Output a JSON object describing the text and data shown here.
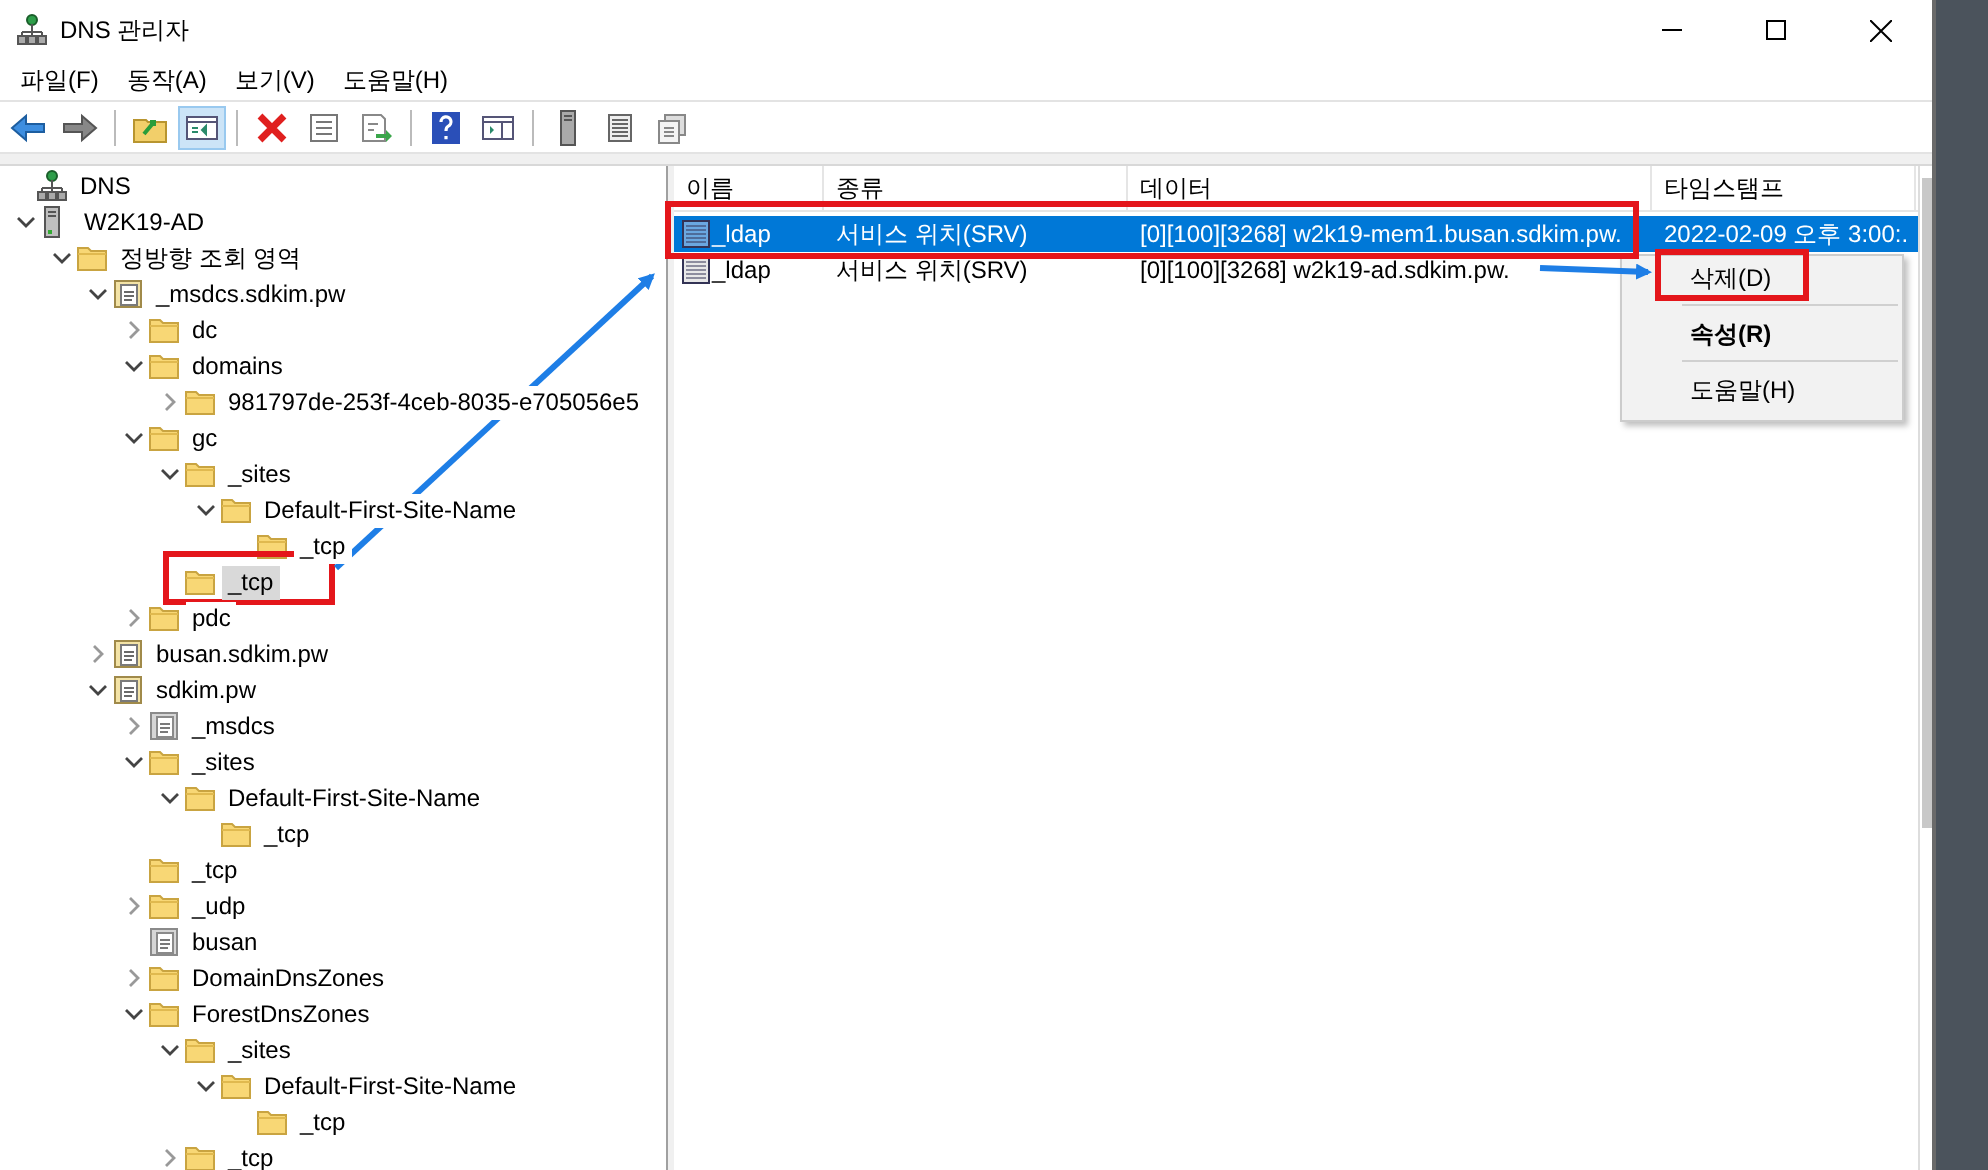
{
  "window": {
    "title": "DNS 관리자"
  },
  "menu": [
    "파일(F)",
    "동작(A)",
    "보기(V)",
    "도움말(H)"
  ],
  "toolbar": [
    {
      "kind": "back"
    },
    {
      "kind": "forward"
    },
    {
      "kind": "sep"
    },
    {
      "kind": "up"
    },
    {
      "kind": "tree-toggle",
      "pressed": true
    },
    {
      "kind": "sep"
    },
    {
      "kind": "delete"
    },
    {
      "kind": "properties"
    },
    {
      "kind": "export"
    },
    {
      "kind": "sep"
    },
    {
      "kind": "help"
    },
    {
      "kind": "action-pane"
    },
    {
      "kind": "sep"
    },
    {
      "kind": "server"
    },
    {
      "kind": "list"
    },
    {
      "kind": "copy"
    }
  ],
  "tree": [
    {
      "label": "DNS",
      "kind": "dns",
      "selected": false,
      "children": [
        {
          "label": "W2K19-AD",
          "kind": "server",
          "expanded": true,
          "selected": false,
          "children": [
            {
              "label": "정방향 조회 영역",
              "kind": "folder",
              "expanded": true,
              "selected": false,
              "children": [
                {
                  "label": "_msdcs.sdkim.pw",
                  "kind": "zone",
                  "expanded": true,
                  "selected": false,
                  "children": [
                    {
                      "label": "dc",
                      "kind": "folder",
                      "expanded": false,
                      "selected": false
                    },
                    {
                      "label": "domains",
                      "kind": "folder",
                      "expanded": true,
                      "selected": false,
                      "children": [
                        {
                          "label": "981797de-253f-4ceb-8035-e705056e5",
                          "kind": "folder",
                          "expanded": false,
                          "selected": false
                        }
                      ]
                    },
                    {
                      "label": "gc",
                      "kind": "folder",
                      "expanded": true,
                      "selected": false,
                      "children": [
                        {
                          "label": "_sites",
                          "kind": "folder",
                          "expanded": true,
                          "selected": false,
                          "children": [
                            {
                              "label": "Default-First-Site-Name",
                              "kind": "folder",
                              "expanded": true,
                              "selected": false,
                              "children": [
                                {
                                  "label": "_tcp",
                                  "kind": "folder",
                                  "selected": false
                                }
                              ]
                            }
                          ]
                        },
                        {
                          "label": "_tcp",
                          "kind": "folder",
                          "selected": true
                        }
                      ]
                    },
                    {
                      "label": "pdc",
                      "kind": "folder",
                      "expanded": false,
                      "selected": false
                    }
                  ]
                },
                {
                  "label": "busan.sdkim.pw",
                  "kind": "zone",
                  "expanded": false,
                  "selected": false
                },
                {
                  "label": "sdkim.pw",
                  "kind": "zone",
                  "expanded": true,
                  "selected": false,
                  "children": [
                    {
                      "label": "_msdcs",
                      "kind": "delegation",
                      "expanded": false,
                      "selected": false
                    },
                    {
                      "label": "_sites",
                      "kind": "folder",
                      "expanded": true,
                      "selected": false,
                      "children": [
                        {
                          "label": "Default-First-Site-Name",
                          "kind": "folder",
                          "expanded": true,
                          "selected": false,
                          "children": [
                            {
                              "label": "_tcp",
                              "kind": "folder",
                              "selected": false
                            }
                          ]
                        }
                      ]
                    },
                    {
                      "label": "_tcp",
                      "kind": "folder",
                      "selected": false
                    },
                    {
                      "label": "_udp",
                      "kind": "folder",
                      "expanded": false,
                      "selected": false
                    },
                    {
                      "label": "busan",
                      "kind": "delegation",
                      "selected": false
                    },
                    {
                      "label": "DomainDnsZones",
                      "kind": "folder",
                      "expanded": false,
                      "selected": false
                    },
                    {
                      "label": "ForestDnsZones",
                      "kind": "folder",
                      "expanded": true,
                      "selected": false,
                      "children": [
                        {
                          "label": "_sites",
                          "kind": "folder",
                          "expanded": true,
                          "selected": false,
                          "children": [
                            {
                              "label": "Default-First-Site-Name",
                              "kind": "folder",
                              "expanded": true,
                              "selected": false,
                              "children": [
                                {
                                  "label": "_tcp",
                                  "kind": "folder",
                                  "selected": false
                                }
                              ]
                            }
                          ]
                        },
                        {
                          "label": "_tcp",
                          "kind": "folder",
                          "expanded": false,
                          "selected": false
                        }
                      ]
                    }
                  ]
                }
              ]
            }
          ]
        }
      ]
    }
  ],
  "list": {
    "columns": [
      "이름",
      "종류",
      "데이터",
      "타임스탬프"
    ],
    "rows": [
      {
        "cells": [
          "_ldap",
          "서비스 위치(SRV)",
          "[0][100][3268] w2k19-mem1.busan.sdkim.pw.",
          "2022-02-09 오후 3:00:."
        ],
        "selected": true
      },
      {
        "cells": [
          "_ldap",
          "서비스 위치(SRV)",
          "[0][100][3268] w2k19-ad.sdkim.pw."
        ],
        "selected": false
      }
    ]
  },
  "context_menu": [
    {
      "label": "삭제(D)",
      "bold": false
    },
    {
      "label": "속성(R)",
      "bold": true
    },
    {
      "label": "도움말(H)",
      "bold": false
    }
  ]
}
